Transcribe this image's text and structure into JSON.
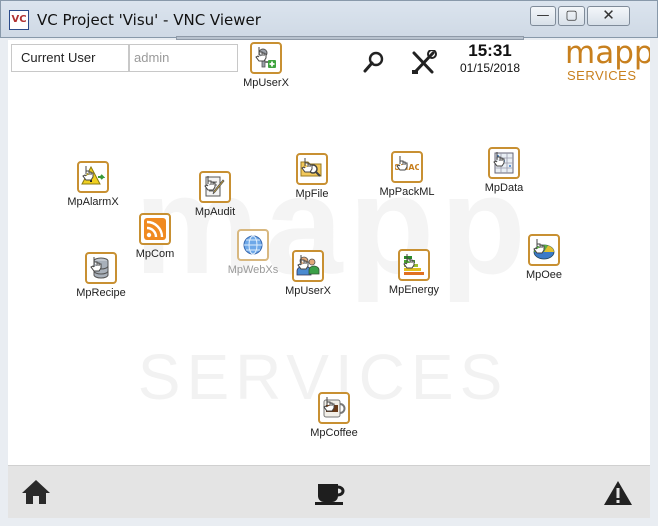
{
  "window": {
    "title": "VC Project 'Visu' - VNC Viewer",
    "icon_text": "VC",
    "minimize_glyph": "—",
    "maximize_glyph": "▢",
    "close_glyph": "✕"
  },
  "header": {
    "current_user_label": "Current User",
    "current_user_value": "admin",
    "top_module_label": "MpUserX",
    "time": "15:31",
    "date": "01/15/2018",
    "logo_word": "mapp",
    "logo_sub": "SERVICES"
  },
  "watermark": {
    "word": "mapp",
    "sub": "SERVICES"
  },
  "modules": {
    "alarmx": "MpAlarmX",
    "audit": "MpAudit",
    "file": "MpFile",
    "packml": "MpPackML",
    "data": "MpData",
    "com": "MpCom",
    "webxs": "MpWebXs",
    "recipe": "MpRecipe",
    "userx": "MpUserX",
    "energy": "MpEnergy",
    "oee": "MpOee",
    "coffee": "MpCoffee"
  },
  "icon_text": {
    "omac": "OMAC"
  },
  "icons": {
    "home": "home-icon",
    "coffee": "coffee-cup-icon",
    "warning": "warning-icon",
    "search": "search-icon",
    "settings": "wrench-screwdriver-icon"
  },
  "colors": {
    "accent": "#c8801e",
    "icon_border": "#c89032"
  }
}
